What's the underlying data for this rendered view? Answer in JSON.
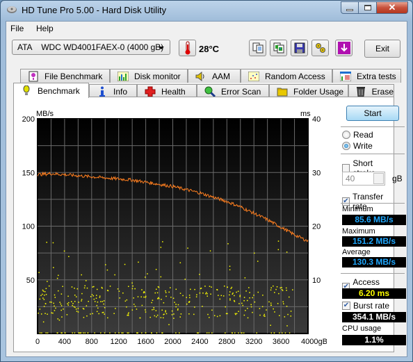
{
  "window": {
    "title": "HD Tune Pro 5.00 - Hard Disk Utility"
  },
  "menu": [
    {
      "label": "File"
    },
    {
      "label": "Help"
    }
  ],
  "toolbar": {
    "drive_select_value": "ATA    WDC WD4001FAEX-0 (4000 gB)",
    "temperature": "28°C",
    "buttons": [
      {
        "icon": "copy-text-icon"
      },
      {
        "icon": "copy-image-icon"
      },
      {
        "icon": "save-icon"
      },
      {
        "icon": "options-icon"
      },
      {
        "icon": "download-icon"
      }
    ],
    "exit_label": "Exit"
  },
  "tabs": {
    "row1": [
      {
        "label": "File Benchmark",
        "icon": "file-benchmark-icon"
      },
      {
        "label": "Disk monitor",
        "icon": "disk-monitor-icon"
      },
      {
        "label": "AAM",
        "icon": "speaker-icon"
      },
      {
        "label": "Random Access",
        "icon": "random-access-icon"
      },
      {
        "label": "Extra tests",
        "icon": "extra-tests-icon"
      }
    ],
    "row2": [
      {
        "label": "Benchmark",
        "icon": "benchmark-icon",
        "active": true
      },
      {
        "label": "Info",
        "icon": "info-icon"
      },
      {
        "label": "Health",
        "icon": "health-icon"
      },
      {
        "label": "Error Scan",
        "icon": "error-scan-icon"
      },
      {
        "label": "Folder Usage",
        "icon": "folder-icon"
      },
      {
        "label": "Erase",
        "icon": "trash-icon"
      }
    ]
  },
  "controls": {
    "start_label": "Start",
    "read_label": "Read",
    "write_label": "Write",
    "mode_selected": "Write",
    "short_stroke_label": "Short stroke",
    "short_stroke_checked": false,
    "short_stroke_value": "40",
    "short_stroke_unit": "gB",
    "transfer_rate_label": "Transfer rate",
    "transfer_rate_checked": true,
    "minimum_label": "Minimum",
    "minimum_value": "85.6 MB/s",
    "maximum_label": "Maximum",
    "maximum_value": "151.2 MB/s",
    "average_label": "Average",
    "average_value": "130.3 MB/s",
    "access_time_label": "Access time",
    "access_time_checked": true,
    "access_time_value": "6.20 ms",
    "burst_rate_label": "Burst rate",
    "burst_rate_checked": true,
    "burst_rate_value": "354.1 MB/s",
    "cpu_usage_label": "CPU usage",
    "cpu_usage_value": "1.1%"
  },
  "colors": {
    "transfer_line": "#ff7f1f",
    "access_dots": "#ffff00",
    "value_blue": "#1fa8ff",
    "value_yellow": "#ffff00",
    "value_white": "#ffffff"
  },
  "chart_data": {
    "type": "line",
    "title": "",
    "xlabel": "gB",
    "ylabel": "MB/s",
    "y2label": "ms",
    "xlim": [
      0,
      4000
    ],
    "ylim": [
      0,
      200
    ],
    "y2lim": [
      0,
      40
    ],
    "x_ticks": [
      "0",
      "400",
      "800",
      "1200",
      "1600",
      "2000",
      "2400",
      "2800",
      "3200",
      "3600",
      "4000gB"
    ],
    "y_ticks": [
      "50",
      "100",
      "150",
      "200"
    ],
    "y2_ticks": [
      "10",
      "20",
      "30",
      "40"
    ],
    "grid": true,
    "series": [
      {
        "name": "Transfer rate (MB/s)",
        "x": [
          0,
          200,
          400,
          600,
          800,
          1000,
          1200,
          1400,
          1600,
          1800,
          2000,
          2200,
          2400,
          2600,
          2800,
          3000,
          3200,
          3400,
          3600,
          3800,
          4000
        ],
        "values": [
          148,
          149,
          148,
          147,
          146,
          145,
          144,
          143,
          141,
          139,
          137,
          134,
          131,
          127,
          123,
          118,
          112,
          106,
          99,
          92,
          86
        ]
      },
      {
        "name": "Access time (ms)",
        "type": "scatter",
        "description": "scattered points mostly between 2 and 12 ms, dense band 3-9 ms, with a line of points near 0 ms; occasional outliers up to ~17 ms",
        "summary_average_ms": 6.2
      }
    ]
  }
}
